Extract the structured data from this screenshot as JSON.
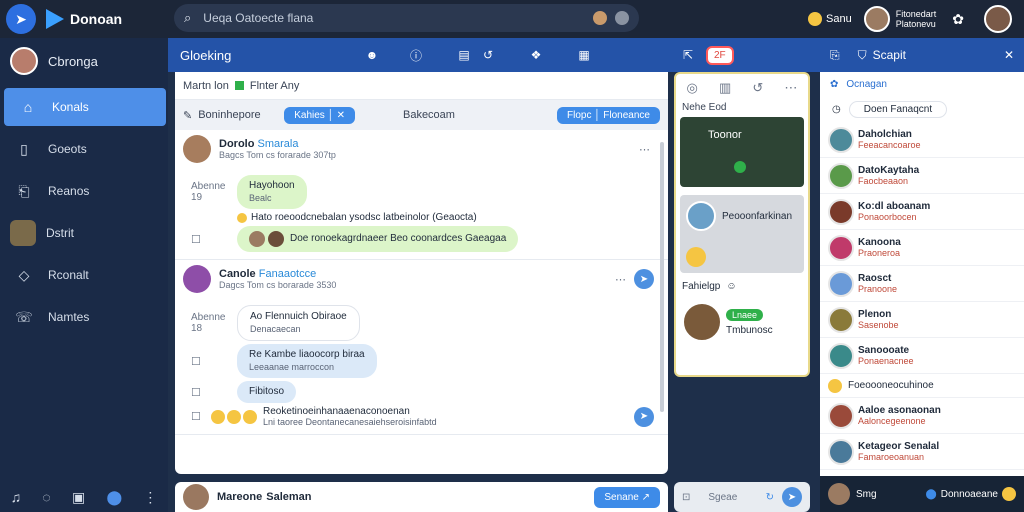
{
  "app": {
    "name": "Donoan"
  },
  "topbar": {
    "search_text": "Ueqa Oatoecte flana",
    "status_label": "Sanu",
    "user_label": "Fitonedart\nPlatonevu"
  },
  "sidebar": {
    "profile_name": "Cbronga",
    "items": [
      {
        "label": "Konals",
        "icon": "home-icon"
      },
      {
        "label": "Goeots",
        "icon": "document-icon"
      },
      {
        "label": "Reanos",
        "icon": "chart-icon"
      },
      {
        "label": "Dstrit",
        "icon": "avatar"
      },
      {
        "label": "Rconalt",
        "icon": "tag-icon"
      },
      {
        "label": "Namtes",
        "icon": "chat-icon"
      }
    ]
  },
  "main": {
    "title": "Gloeking",
    "header_button": "2F",
    "filter_label": "Martn lon",
    "filter_value": "Flnter Any",
    "tab_left": "Boninhepore",
    "tab_left_pill": "Kahies │ ✕",
    "tab_mid": "Bakecoam",
    "tab_right_pill": "Flopc │ Floneance",
    "thread1": {
      "name": "Dorolo",
      "tag": "Smarala",
      "sub": "Bagcs Tom cs forarade 307tp",
      "label1": "Abenne",
      "label1b": "19",
      "bubble1_title": "Hayohoon",
      "bubble1_sub": "Bealc",
      "line2": "Hato roeoodcnebalan ysodsc latbeinolor (Geaocta)",
      "bubble2": "Doe ronoekagrdnaeer Beo coonardces Gaeagaa"
    },
    "thread2": {
      "name": "Canole",
      "tag": "Fanaaotcce",
      "sub": "Dagcs Tom cs borarade 3530",
      "label1": "Abenne",
      "label1b": "18",
      "bubble1_title": "Ao Flennuich Obiraoe",
      "bubble1_sub": "Denacaecan",
      "bubble2_title": "Re Kambe liaoocorp biraa",
      "bubble2_sub": "Leeaanae marroccon",
      "bubble3": "Fibitoso",
      "line4": "Reoketinoeinhanaaenaconoenan",
      "line4b": "Lni taoree Deontanecanesaiehseroisinfabtd"
    }
  },
  "composer": {
    "name": "Mareone",
    "tag": "Saleman",
    "send": "Senane"
  },
  "middle": {
    "label": "Nehe Eod",
    "map_text": "Toonor",
    "card_name": "Peooonfarkinan",
    "status_label": "Fahielgp",
    "badge": "Lnaee",
    "card2_name": "Tmbunosc",
    "search_text": "Sgeae"
  },
  "right": {
    "title": "Scapit",
    "sub_label": "Ocnagan",
    "filter_text": "Doen Fanaqcnt",
    "items": [
      {
        "name": "Daholchian",
        "sub": "Feeacancoaroe"
      },
      {
        "name": "DatoKaytaha",
        "sub": "Faocbeaaon"
      },
      {
        "name": "Ko:dl aboanam",
        "sub": "Ponaoorbocen"
      },
      {
        "name": "Kanoona",
        "sub": "Praoneroa"
      },
      {
        "name": "Raosct",
        "sub": "Pranoone"
      },
      {
        "name": "Plenon",
        "sub": "Sasenobe"
      },
      {
        "name": "Sanoooate",
        "sub": "Ponaenacnee"
      },
      {
        "name": "Foeoooneocuhinoe",
        "sub": ""
      },
      {
        "name": "Aaloe asonaonan",
        "sub": "Aaloncegeenone"
      },
      {
        "name": "Ketageor Senalal",
        "sub": "Famaroeoanuan"
      }
    ],
    "footer_left": "Smg",
    "footer_right": "Donnoaeane"
  }
}
